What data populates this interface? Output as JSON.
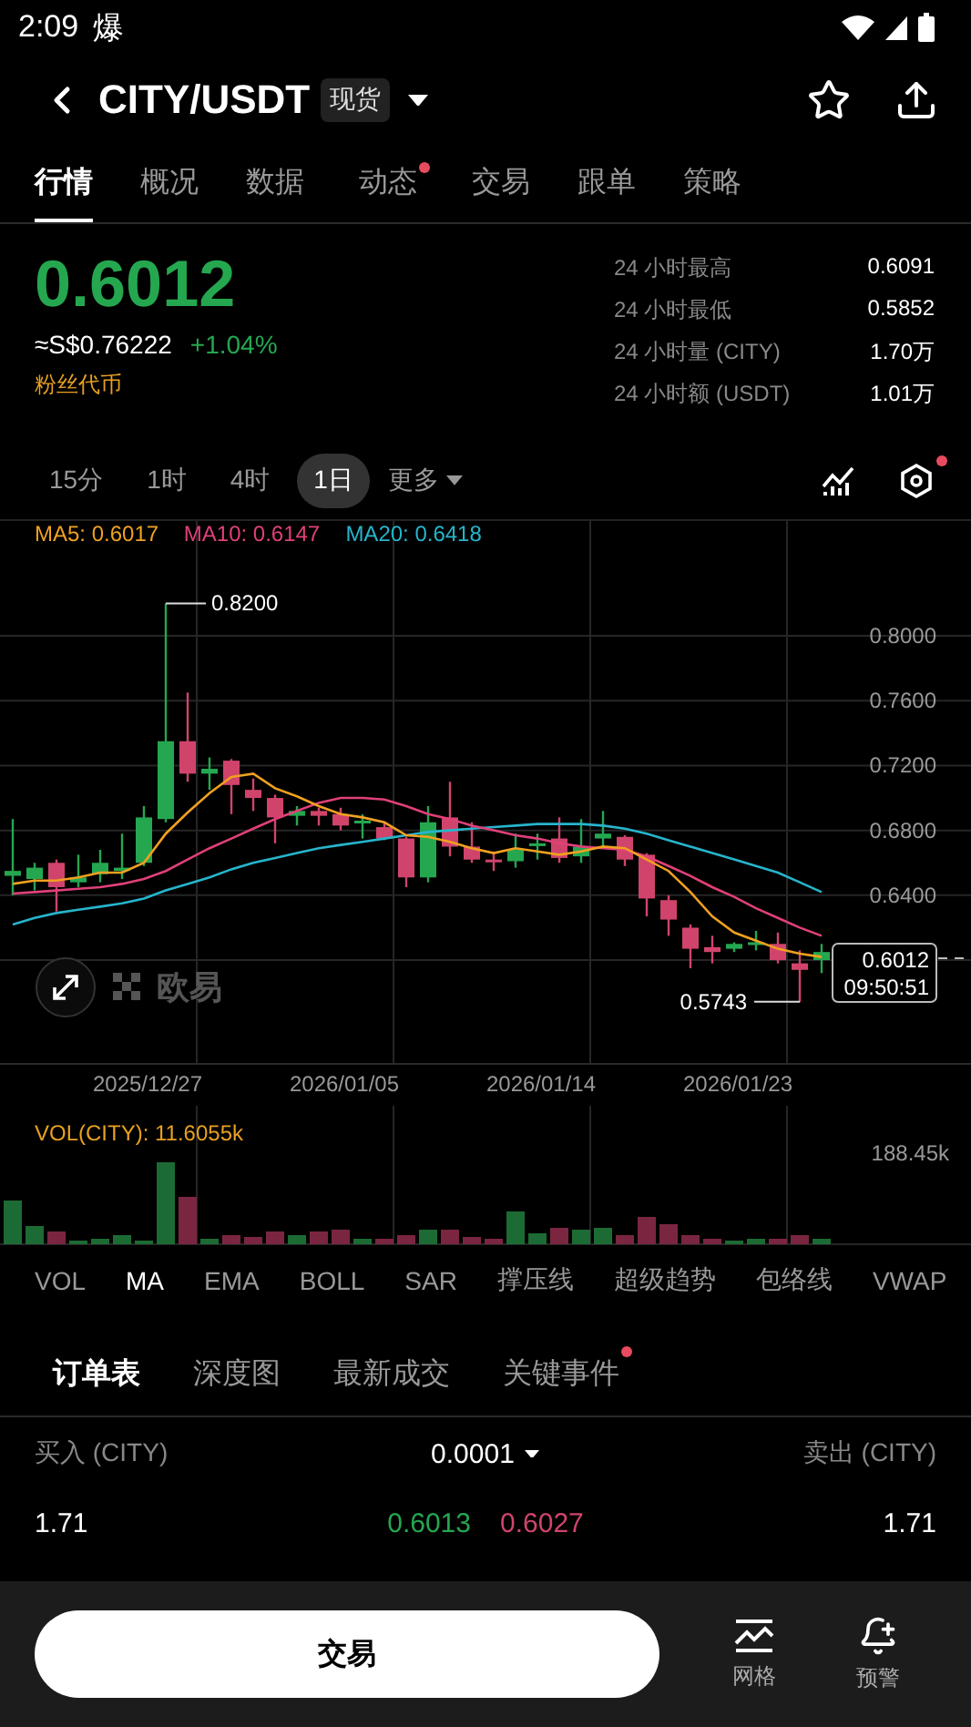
{
  "status_bar": {
    "time": "2:09",
    "notification": "爆"
  },
  "header": {
    "pair": "CITY/USDT",
    "market_badge": "现货"
  },
  "tabs": [
    {
      "label": "行情",
      "selected": true,
      "dot": false
    },
    {
      "label": "概况",
      "selected": false,
      "dot": false
    },
    {
      "label": "数据",
      "selected": false,
      "dot": false
    },
    {
      "label": "动态",
      "selected": false,
      "dot": true
    },
    {
      "label": "交易",
      "selected": false,
      "dot": false
    },
    {
      "label": "跟单",
      "selected": false,
      "dot": false
    },
    {
      "label": "策略",
      "selected": false,
      "dot": false
    }
  ],
  "ticker": {
    "price": "0.6012",
    "fiat_price": "≈S$0.76222",
    "change": "+1.04%",
    "tag": "粉丝代币",
    "stats": [
      {
        "label": "24 小时最高",
        "value": "0.6091"
      },
      {
        "label": "24 小时最低",
        "value": "0.5852"
      },
      {
        "label": "24 小时量 (CITY)",
        "value": "1.70万"
      },
      {
        "label": "24 小时额 (USDT)",
        "value": "1.01万"
      }
    ]
  },
  "timeframes": [
    {
      "label": "15分",
      "selected": false
    },
    {
      "label": "1时",
      "selected": false
    },
    {
      "label": "4时",
      "selected": false
    },
    {
      "label": "1日",
      "selected": true
    }
  ],
  "more": "更多",
  "settings_dot": true,
  "chart": {
    "high_label": "0.8200",
    "low_label": "0.5743",
    "last_price": "0.6012",
    "countdown": "09:50:51",
    "watermark": "欧易",
    "chart_data": {
      "type": "candlestick",
      "ylim": [
        0.536,
        0.8708
      ],
      "grid": true,
      "categories": [
        null,
        null,
        null,
        null,
        null,
        null,
        "2025/12/27",
        null,
        null,
        null,
        null,
        null,
        null,
        null,
        null,
        "2026/01/05",
        null,
        null,
        null,
        null,
        null,
        null,
        null,
        null,
        "2026/01/14",
        null,
        null,
        null,
        null,
        null,
        null,
        null,
        null,
        "2026/01/23",
        null,
        null,
        null,
        null
      ],
      "yticks": [
        {
          "value": 0.8,
          "label": "0.8000"
        },
        {
          "value": 0.76,
          "label": "0.7600"
        },
        {
          "value": 0.72,
          "label": "0.7200"
        },
        {
          "value": 0.68,
          "label": "0.6800"
        },
        {
          "value": 0.64,
          "label": "0.6400"
        }
      ],
      "ohlc": [
        [
          0.652,
          0.687,
          0.64,
          0.655
        ],
        [
          0.65,
          0.66,
          0.643,
          0.657
        ],
        [
          0.66,
          0.662,
          0.63,
          0.645
        ],
        [
          0.648,
          0.665,
          0.645,
          0.651
        ],
        [
          0.653,
          0.668,
          0.648,
          0.66
        ],
        [
          0.655,
          0.678,
          0.65,
          0.657
        ],
        [
          0.66,
          0.695,
          0.658,
          0.688
        ],
        [
          0.687,
          0.82,
          0.685,
          0.735
        ],
        [
          0.735,
          0.765,
          0.71,
          0.715
        ],
        [
          0.715,
          0.725,
          0.705,
          0.718
        ],
        [
          0.723,
          0.724,
          0.69,
          0.708
        ],
        [
          0.705,
          0.712,
          0.692,
          0.7
        ],
        [
          0.7,
          0.702,
          0.672,
          0.688
        ],
        [
          0.689,
          0.695,
          0.683,
          0.692
        ],
        [
          0.692,
          0.694,
          0.683,
          0.689
        ],
        [
          0.69,
          0.694,
          0.68,
          0.683
        ],
        [
          0.685,
          0.69,
          0.675,
          0.686
        ],
        [
          0.682,
          0.685,
          0.674,
          0.675
        ],
        [
          0.675,
          0.676,
          0.645,
          0.651
        ],
        [
          0.651,
          0.695,
          0.648,
          0.685
        ],
        [
          0.688,
          0.71,
          0.664,
          0.67
        ],
        [
          0.67,
          0.685,
          0.66,
          0.662
        ],
        [
          0.662,
          0.667,
          0.655,
          0.661
        ],
        [
          0.661,
          0.678,
          0.657,
          0.668
        ],
        [
          0.671,
          0.678,
          0.662,
          0.672
        ],
        [
          0.675,
          0.688,
          0.66,
          0.663
        ],
        [
          0.664,
          0.687,
          0.66,
          0.67
        ],
        [
          0.675,
          0.692,
          0.67,
          0.678
        ],
        [
          0.676,
          0.677,
          0.658,
          0.662
        ],
        [
          0.665,
          0.666,
          0.627,
          0.638
        ],
        [
          0.637,
          0.64,
          0.615,
          0.625
        ],
        [
          0.62,
          0.622,
          0.595,
          0.607
        ],
        [
          0.608,
          0.615,
          0.598,
          0.605
        ],
        [
          0.607,
          0.611,
          0.605,
          0.61
        ],
        [
          0.61,
          0.618,
          0.606,
          0.611
        ],
        [
          0.61,
          0.617,
          0.598,
          0.6
        ],
        [
          0.598,
          0.606,
          0.574,
          0.594
        ],
        [
          0.6,
          0.61,
          0.592,
          0.605
        ]
      ],
      "series": [
        {
          "name": "MA5: 0.6017",
          "type": "line",
          "color": "#f0a020",
          "values": [
            0.647,
            0.649,
            0.649,
            0.651,
            0.654,
            0.654,
            0.66,
            0.678,
            0.691,
            0.703,
            0.713,
            0.715,
            0.706,
            0.701,
            0.695,
            0.69,
            0.688,
            0.685,
            0.677,
            0.676,
            0.673,
            0.669,
            0.666,
            0.669,
            0.667,
            0.665,
            0.667,
            0.67,
            0.669,
            0.662,
            0.655,
            0.642,
            0.627,
            0.617,
            0.612,
            0.607,
            0.604,
            0.602
          ]
        },
        {
          "name": "MA10: 0.6147",
          "type": "line",
          "color": "#e0407a",
          "values": [
            0.641,
            0.642,
            0.643,
            0.644,
            0.645,
            0.647,
            0.65,
            0.655,
            0.662,
            0.669,
            0.675,
            0.681,
            0.687,
            0.692,
            0.697,
            0.7,
            0.7,
            0.699,
            0.695,
            0.69,
            0.687,
            0.683,
            0.68,
            0.677,
            0.675,
            0.672,
            0.67,
            0.669,
            0.668,
            0.664,
            0.658,
            0.652,
            0.645,
            0.639,
            0.632,
            0.626,
            0.62,
            0.615
          ]
        },
        {
          "name": "MA20: 0.6418",
          "type": "line",
          "color": "#26b5cc",
          "values": [
            0.622,
            0.626,
            0.629,
            0.631,
            0.633,
            0.635,
            0.638,
            0.643,
            0.647,
            0.651,
            0.656,
            0.66,
            0.663,
            0.666,
            0.669,
            0.671,
            0.673,
            0.675,
            0.677,
            0.679,
            0.68,
            0.681,
            0.682,
            0.683,
            0.684,
            0.684,
            0.684,
            0.683,
            0.681,
            0.678,
            0.674,
            0.67,
            0.666,
            0.662,
            0.658,
            0.654,
            0.648,
            0.642
          ]
        }
      ]
    }
  },
  "volume": {
    "legend": "VOL(CITY): 11.6055k",
    "max_label": "188.45k"
  },
  "indicators": [
    {
      "label": "VOL",
      "selected": false
    },
    {
      "label": "MA",
      "selected": true
    },
    {
      "label": "EMA",
      "selected": false
    },
    {
      "label": "BOLL",
      "selected": false
    },
    {
      "label": "SAR",
      "selected": false
    },
    {
      "label": "撑压线",
      "selected": false
    },
    {
      "label": "超级趋势",
      "selected": false
    },
    {
      "label": "包络线",
      "selected": false
    },
    {
      "label": "VWAP",
      "selected": false
    }
  ],
  "book_tabs": [
    {
      "label": "订单表",
      "selected": true,
      "dot": false
    },
    {
      "label": "深度图",
      "selected": false,
      "dot": false
    },
    {
      "label": "最新成交",
      "selected": false,
      "dot": false
    },
    {
      "label": "关键事件",
      "selected": false,
      "dot": true
    }
  ],
  "order_book": {
    "bid_header": "买入 (CITY)",
    "precision": "0.0001",
    "ask_header": "卖出 (CITY)",
    "rows": [
      {
        "bid_size": "1.71",
        "bid_price": "0.6013",
        "ask_price": "0.6027",
        "ask_size": "1.71"
      }
    ]
  },
  "bottom_bar": {
    "trade_button": "交易",
    "actions": [
      {
        "label": "网格",
        "kind": "grid"
      },
      {
        "label": "预警",
        "kind": "alert"
      }
    ]
  }
}
